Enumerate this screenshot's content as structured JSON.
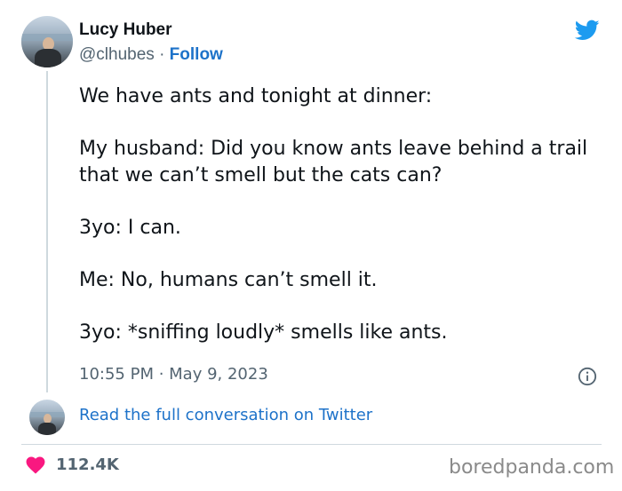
{
  "author": {
    "name": "Lucy Huber",
    "handle": "@clhubes",
    "separator": "·",
    "follow_label": "Follow"
  },
  "brand_icon": "twitter-bird-icon",
  "tweet": {
    "paragraphs": [
      "We have ants and tonight at dinner:",
      "My husband: Did you know ants leave behind a trail that we can’t smell but the cats can?",
      "3yo: I can.",
      "Me: No, humans can’t smell it.",
      "3yo: *sniffing loudly* smells like ants."
    ],
    "timestamp": "10:55 PM · May 9, 2023"
  },
  "read_full_link": "Read the full conversation on Twitter",
  "engagement": {
    "likes": "112.4K",
    "like_icon": "heart-icon"
  },
  "watermark": "boredpanda.com",
  "colors": {
    "link": "#1d72c9",
    "twitter_blue": "#1d9bf0",
    "heart": "#f91880",
    "muted": "#536471"
  }
}
